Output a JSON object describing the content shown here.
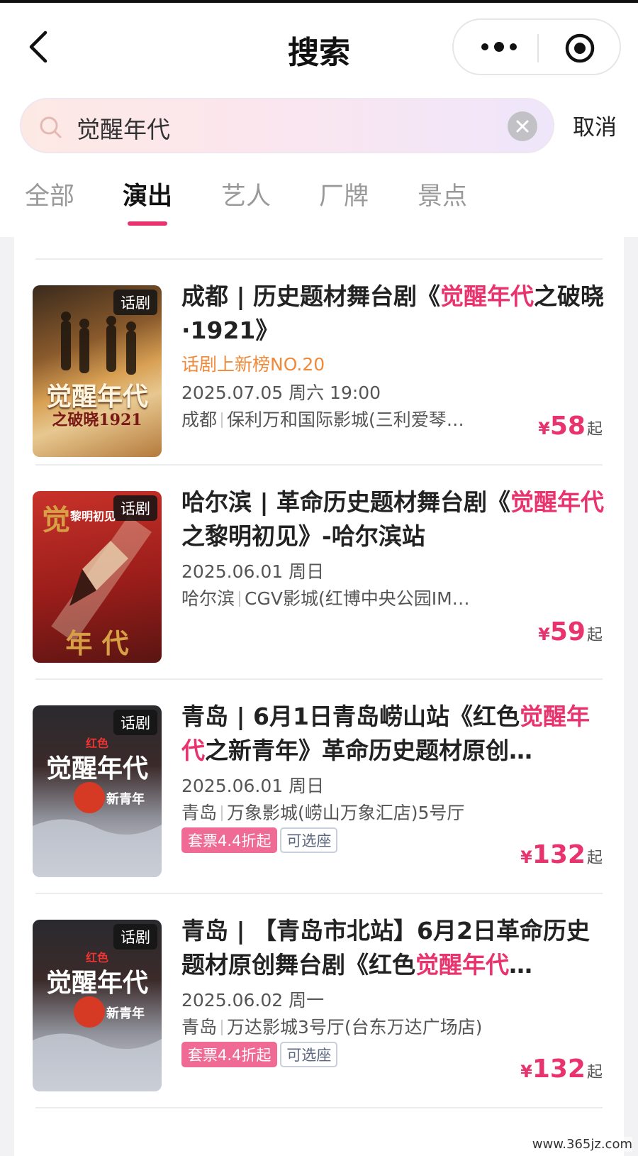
{
  "header": {
    "title": "搜索",
    "back_icon": "chevron-left-icon",
    "more_icon": "more-dots-icon",
    "target_icon": "target-icon"
  },
  "search": {
    "query": "觉醒年代",
    "cancel_label": "取消"
  },
  "tabs": [
    {
      "label": "全部"
    },
    {
      "label": "演出"
    },
    {
      "label": "艺人"
    },
    {
      "label": "厂牌"
    },
    {
      "label": "景点"
    }
  ],
  "accent_color": "#e8336e",
  "items": [
    {
      "badge": "话剧",
      "title_pre": "成都 | 历史题材舞台剧《",
      "title_hl1": "觉醒年代",
      "title_mid": "之破晓·1921》",
      "title_hl2": "",
      "title_post": "",
      "rank": "话剧上新榜NO.20",
      "date": "2025.07.05 周六 19:00",
      "city": "成都",
      "venue": "保利万和国际影城(三利爱琴…",
      "tag1": "",
      "tag2": "",
      "price": "58",
      "currency": "¥",
      "price_suffix": "起",
      "poster_title": "觉醒年代",
      "poster_sub": "之破晓1921"
    },
    {
      "badge": "话剧",
      "title_pre": "哈尔滨 | 革命历史题材舞台剧《",
      "title_hl1": "觉醒年代",
      "title_mid": "之黎明初见》-哈尔滨站",
      "title_hl2": "",
      "title_post": "",
      "rank": "",
      "date": "2025.06.01 周日",
      "city": "哈尔滨",
      "venue": "CGV影城(红博中央公园IM…",
      "tag1": "",
      "tag2": "",
      "price": "59",
      "currency": "¥",
      "price_suffix": "起",
      "poster_title": "觉",
      "poster_sub": "年  代",
      "poster_small": "黎明初见"
    },
    {
      "badge": "话剧",
      "title_pre": "青岛 | 6月1日青岛崂山站《红色",
      "title_hl1": "觉醒年代",
      "title_mid": "之新青年》革命历史题材原创…",
      "title_hl2": "",
      "title_post": "",
      "rank": "",
      "date": "2025.06.01 周日",
      "city": "青岛",
      "venue": "万象影城(崂山万象汇店)5号厅",
      "tag1": "套票4.4折起",
      "tag2": "可选座",
      "price": "132",
      "currency": "¥",
      "price_suffix": "起",
      "poster_red": "红色",
      "poster_title": "觉醒年代",
      "poster_sub": "新青年"
    },
    {
      "badge": "话剧",
      "title_pre": "青岛 | 【青岛市北站】6月2日革命历史题材原创舞台剧《红色",
      "title_hl1": "觉醒年代",
      "title_mid": "…",
      "title_hl2": "",
      "title_post": "",
      "rank": "",
      "date": "2025.06.02 周一",
      "city": "青岛",
      "venue": "万达影城3号厅(台东万达广场店)",
      "tag1": "套票4.4折起",
      "tag2": "可选座",
      "price": "132",
      "currency": "¥",
      "price_suffix": "起",
      "poster_red": "红色",
      "poster_title": "觉醒年代",
      "poster_sub": "新青年"
    }
  ],
  "watermark": "www.365jz.com"
}
